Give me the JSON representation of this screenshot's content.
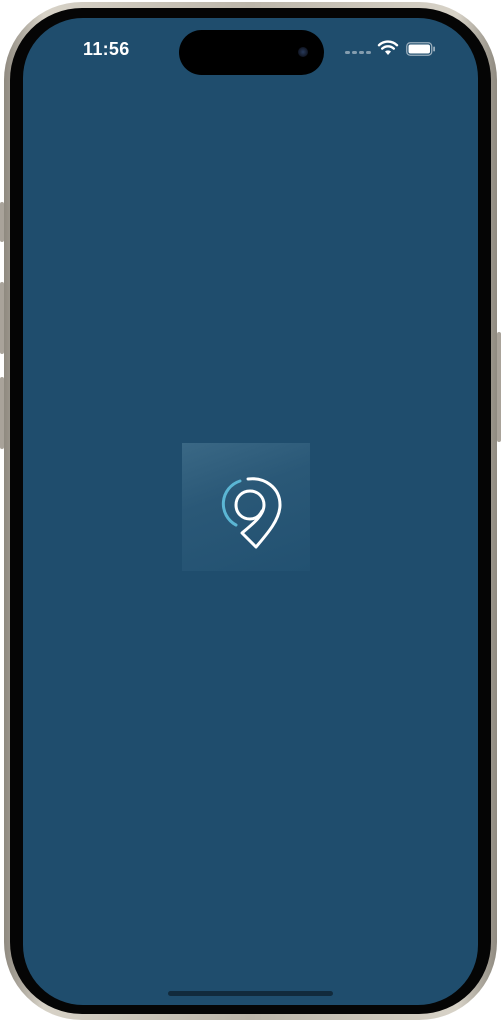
{
  "status_bar": {
    "time": "11:56",
    "wifi_icon": "wifi-icon",
    "battery_icon": "battery-icon",
    "signal_icon": "cellular-signal-icon"
  },
  "splash": {
    "logo_icon": "map-pin-logo-icon",
    "background_color": "#1f4d6d",
    "logo_accent_color": "#5bb6d4",
    "logo_line_color": "#ffffff"
  }
}
